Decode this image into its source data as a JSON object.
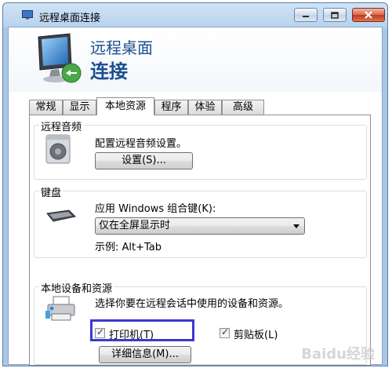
{
  "window": {
    "title": "远程桌面连接",
    "heading_line1": "远程桌面",
    "heading_line2": "连接",
    "controls": {
      "minimize_icon": "minimize-icon",
      "maximize_icon": "maximize-icon",
      "close_icon": "close-icon"
    }
  },
  "tabs": [
    {
      "label": "常规",
      "active": false
    },
    {
      "label": "显示",
      "active": false
    },
    {
      "label": "本地资源",
      "active": true
    },
    {
      "label": "程序",
      "active": false
    },
    {
      "label": "体验",
      "active": false
    },
    {
      "label": "高级",
      "active": false
    }
  ],
  "audio": {
    "title": "远程音频",
    "description": "配置远程音频设置。",
    "settings_button": "设置(S)...",
    "icon": "speaker-icon"
  },
  "keyboard": {
    "title": "键盘",
    "apply_label": "应用 Windows 组合键(K):",
    "selected_option": "仅在全屏显示时",
    "example": "示例: Alt+Tab",
    "icon": "keyboard-icon"
  },
  "local_devices": {
    "title": "本地设备和资源",
    "description": "选择你要在远程会话中使用的设备和资源。",
    "printer_label": "打印机(T)",
    "printer_checked": true,
    "clipboard_label": "剪贴板(L)",
    "clipboard_checked": true,
    "details_button": "详细信息(M)...",
    "icon": "devices-icon"
  },
  "watermark": "Baidu经验"
}
